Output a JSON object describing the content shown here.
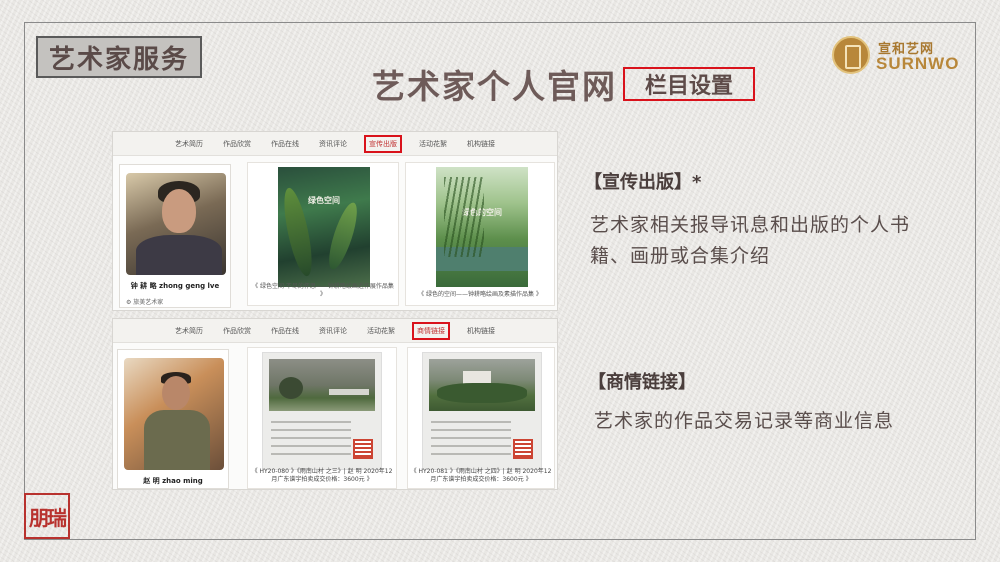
{
  "header": {
    "section_tag": "艺术家服务",
    "title": "艺术家个人官网",
    "subtitle": "栏目设置"
  },
  "logo": {
    "cn": "宣和艺网",
    "en": "SURNWO"
  },
  "panel1": {
    "nav": [
      "艺术简历",
      "作品欣赏",
      "作品在线",
      "资讯评论",
      "宣传出版",
      "活动花絮",
      "机构链接"
    ],
    "active_index": 4,
    "artist": {
      "name": "钟 耕 略    zhong geng lve",
      "sub": "旅美艺术家"
    },
    "books": [
      {
        "cover_text": "绿色空间",
        "caption": "《 绿色空间·不尽的怀思——钟耕略绘画近作展作品集 》"
      },
      {
        "cover_text": "绿色的空间",
        "caption": "《 绿色的空间——钟耕略绘画及素描作品集 》"
      }
    ]
  },
  "panel2": {
    "nav": [
      "艺术简历",
      "作品欣赏",
      "作品在线",
      "资讯评论",
      "活动花絮",
      "商情链接",
      "机构链接"
    ],
    "active_index": 5,
    "artist": {
      "name": "赵 明    zhao ming"
    },
    "artworks": [
      {
        "caption": "《 HY20-080 》《雨南山村 之三》| 赵 明 2020年12月广东谱宇拍卖成交价格：3600元 》"
      },
      {
        "caption": "《 HY20-081 》《雨南山村 之四》| 赵 明 2020年12月广东谱宇拍卖成交价格：3600元 》"
      }
    ]
  },
  "info": {
    "publish_heading": "【宣传出版】*",
    "publish_desc": "艺术家相关报导讯息和出版的个人书籍、画册或合集介绍",
    "business_heading": "【商情链接】",
    "business_desc": "艺术家的作品交易记录等商业信息"
  },
  "seal_text": "朋瑞",
  "colors": {
    "accent_red": "#d9121b",
    "title_brown": "#6e5b59",
    "logo_gold": "#b8873a"
  }
}
